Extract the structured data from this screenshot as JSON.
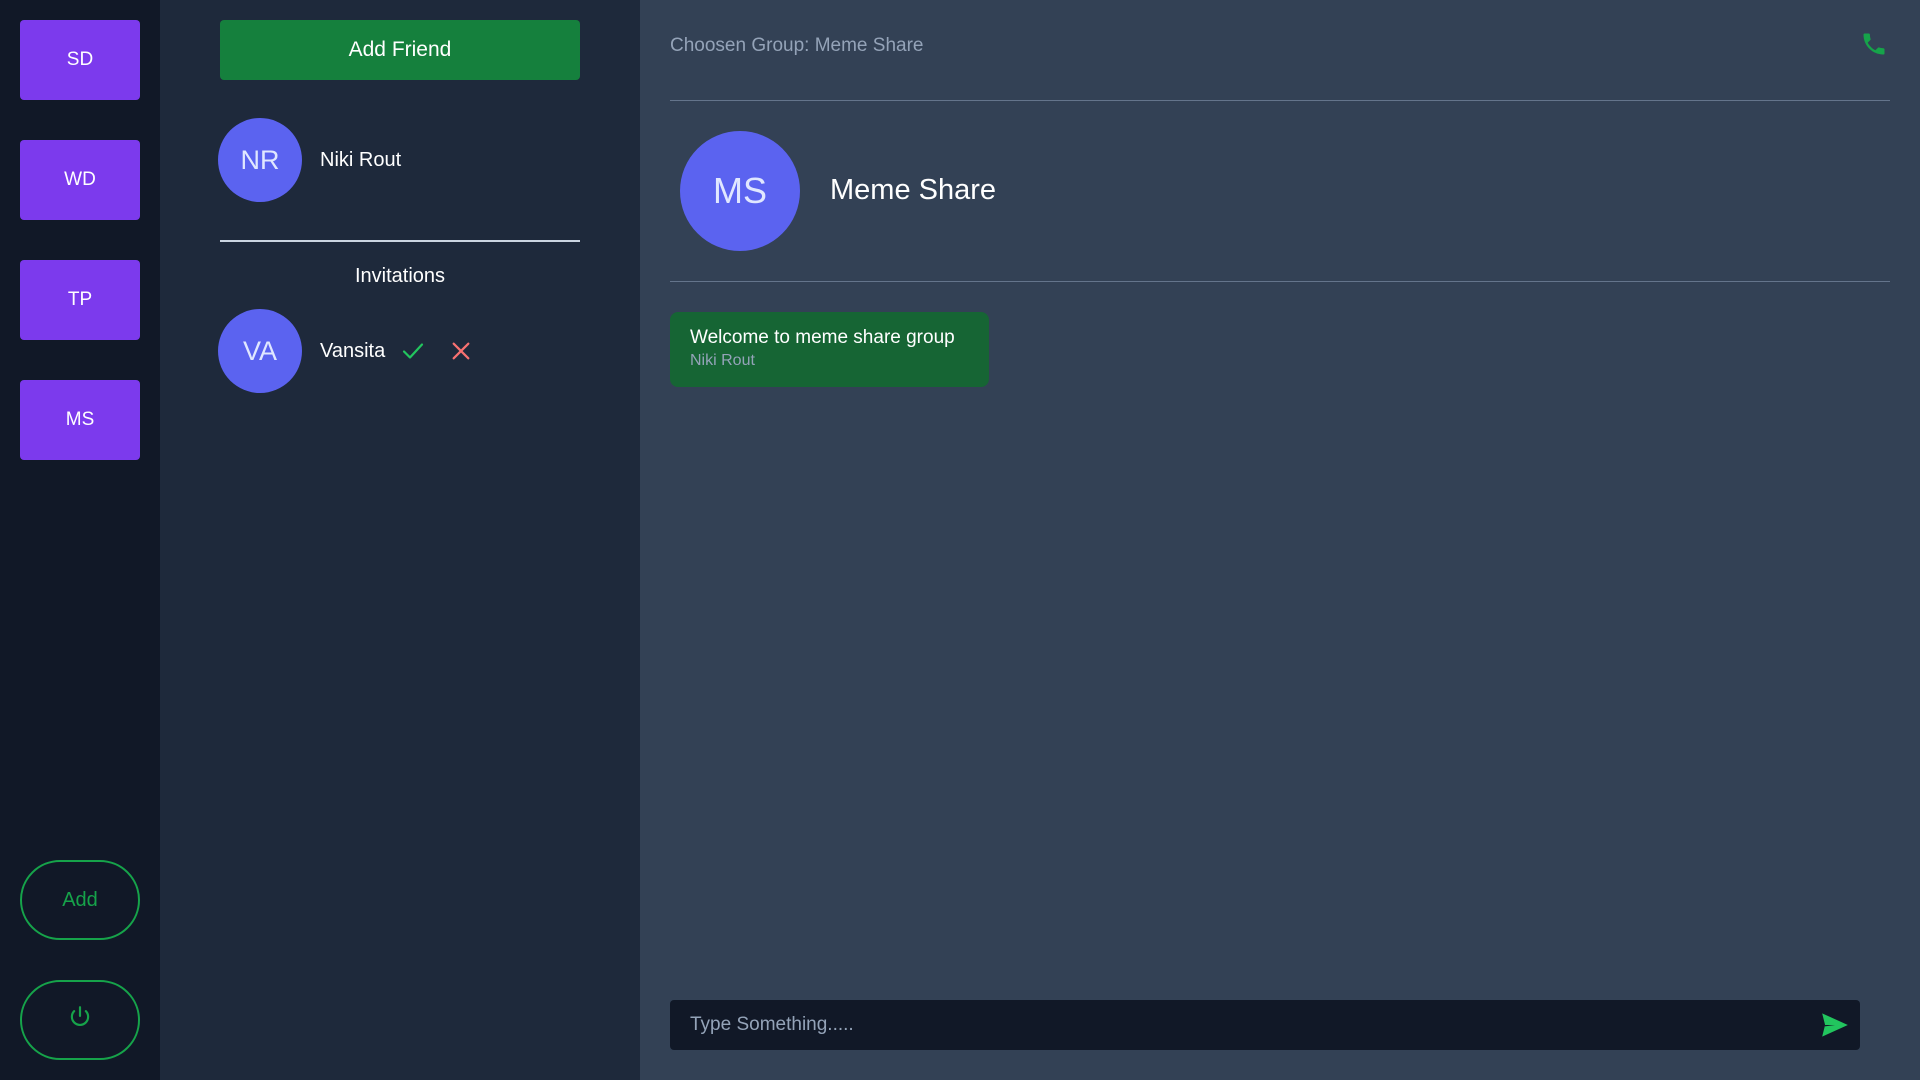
{
  "rail": {
    "groups": [
      {
        "label": "SD"
      },
      {
        "label": "WD"
      },
      {
        "label": "TP"
      },
      {
        "label": "MS"
      }
    ],
    "add_label": "Add",
    "power_icon": "power-icon"
  },
  "friends": {
    "add_friend_label": "Add Friend",
    "list": [
      {
        "initials": "NR",
        "name": "Niki Rout"
      }
    ],
    "invitations_title": "Invitations",
    "invitations": [
      {
        "initials": "VA",
        "name": "Vansita",
        "accept_icon": "check-icon",
        "reject_icon": "close-icon"
      }
    ]
  },
  "chat": {
    "header_label": "Choosen Group: Meme Share",
    "call_icon": "phone-icon",
    "group": {
      "initials": "MS",
      "name": "Meme Share"
    },
    "messages": [
      {
        "text": "Welcome to meme share group",
        "author": "Niki Rout"
      }
    ],
    "composer": {
      "placeholder": "Type Something.....",
      "value": "",
      "send_icon": "send-icon"
    }
  },
  "colors": {
    "rail_bg": "#111827",
    "panel_bg": "#1e293b",
    "chat_bg": "#334155",
    "group_button": "#7c3aed",
    "accent_green": "#16a34a",
    "avatar": "#5b63f0",
    "reject_red": "#f87171"
  }
}
